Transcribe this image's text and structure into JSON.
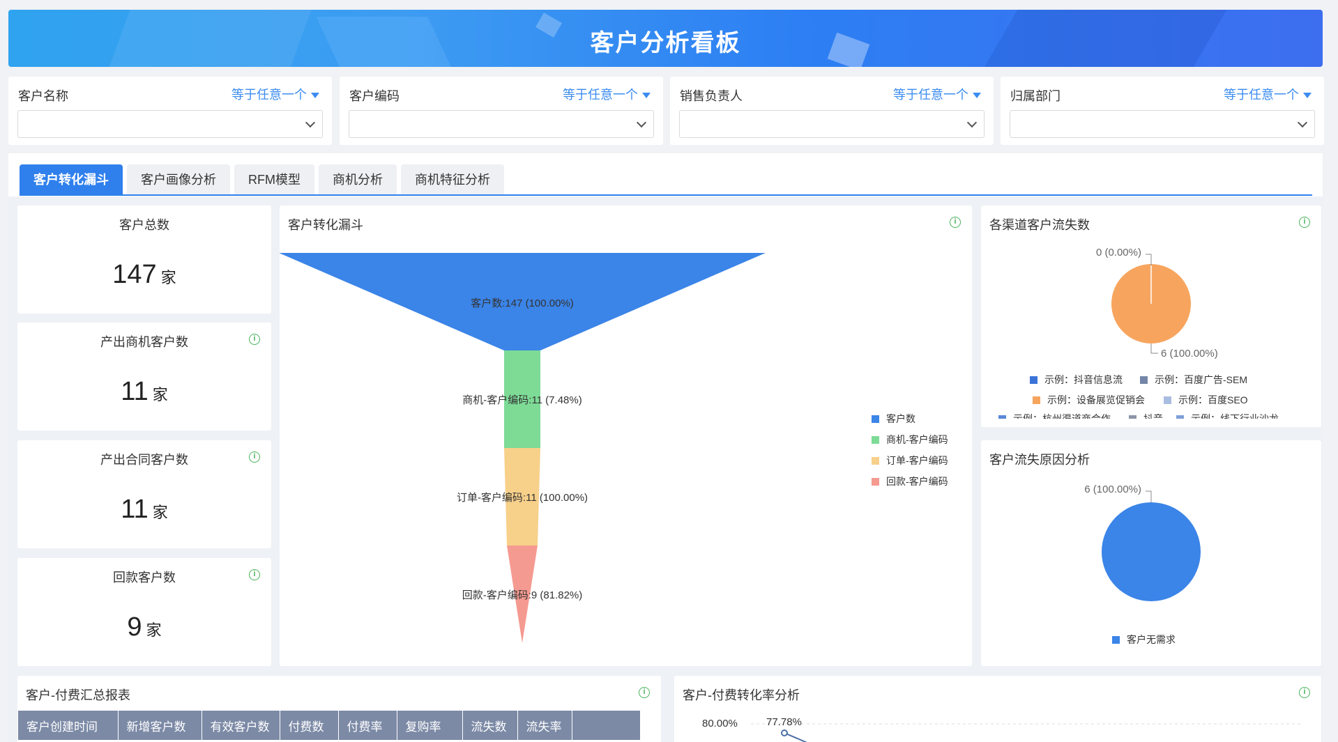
{
  "header": {
    "title": "客户分析看板"
  },
  "filters": [
    {
      "label": "客户名称",
      "operator": "等于任意一个",
      "value": ""
    },
    {
      "label": "客户编码",
      "operator": "等于任意一个",
      "value": ""
    },
    {
      "label": "销售负责人",
      "operator": "等于任意一个",
      "value": ""
    },
    {
      "label": "归属部门",
      "operator": "等于任意一个",
      "value": ""
    }
  ],
  "tabs": [
    {
      "label": "客户转化漏斗",
      "active": true
    },
    {
      "label": "客户画像分析"
    },
    {
      "label": "RFM模型"
    },
    {
      "label": "商机分析"
    },
    {
      "label": "商机特征分析"
    }
  ],
  "kpis": [
    {
      "title": "客户总数",
      "value": "147",
      "unit": "家"
    },
    {
      "title": "产出商机客户数",
      "value": "11",
      "unit": "家"
    },
    {
      "title": "产出合同客户数",
      "value": "11",
      "unit": "家"
    },
    {
      "title": "回款客户数",
      "value": "9",
      "unit": "家"
    }
  ],
  "funnel": {
    "title": "客户转化漏斗",
    "stages": [
      {
        "label": "客户数:147 (100.00%)",
        "legend": "客户数",
        "color": "#3b84e8"
      },
      {
        "label": "商机-客户编码:11 (7.48%)",
        "legend": "商机-客户编码",
        "color": "#7ddb96"
      },
      {
        "label": "订单-客户编码:11 (100.00%)",
        "legend": "订单-客户编码",
        "color": "#f7d08a"
      },
      {
        "label": "回款-客户编码:9 (81.82%)",
        "legend": "回款-客户编码",
        "color": "#f59a90"
      }
    ]
  },
  "churn_channel": {
    "title": "各渠道客户流失数",
    "labels": {
      "top": "0 (0.00%)",
      "bottom": "6 (100.00%)"
    },
    "legend": [
      {
        "name": "示例：抖音信息流",
        "color": "#3b73d8"
      },
      {
        "name": "示例：百度广告-SEM",
        "color": "#7486a8"
      },
      {
        "name": "示例：设备展览促销会",
        "color": "#f7a55e"
      },
      {
        "name": "示例：百度SEO",
        "color": "#a9bde0"
      },
      {
        "name": "示例：杭州渠道商合作",
        "color": "#5b88d8"
      },
      {
        "name": "抖音",
        "color": "#8c95a8"
      },
      {
        "name": "示例：线下行业沙龙",
        "color": "#7f9fd6"
      }
    ]
  },
  "churn_reason": {
    "title": "客户流失原因分析",
    "label": "6 (100.00%)",
    "legend": [
      {
        "name": "客户无需求",
        "color": "#3b84e8"
      }
    ]
  },
  "summary_table": {
    "title": "客户-付费汇总报表",
    "columns": [
      "客户创建时间",
      "新增客户数",
      "有效客户数",
      "付费数",
      "付费率",
      "复购率",
      "流失数",
      "流失率",
      ""
    ]
  },
  "conversion_card": {
    "title": "客户-付费转化率分析",
    "y_tick": "80.00%",
    "point_label": "77.78%"
  },
  "chart_data": [
    {
      "type": "funnel",
      "title": "客户转化漏斗",
      "categories": [
        "客户数",
        "商机-客户编码",
        "订单-客户编码",
        "回款-客户编码"
      ],
      "values": [
        147,
        11,
        11,
        9
      ],
      "percents": [
        100.0,
        7.48,
        100.0,
        81.82
      ]
    },
    {
      "type": "pie",
      "title": "各渠道客户流失数",
      "categories": [
        "示例：设备展览促销会"
      ],
      "values": [
        6
      ],
      "labels": [
        "0 (0.00%)",
        "6 (100.00%)"
      ]
    },
    {
      "type": "pie",
      "title": "客户流失原因分析",
      "categories": [
        "客户无需求"
      ],
      "values": [
        6
      ]
    },
    {
      "type": "line",
      "title": "客户-付费转化率分析",
      "y_ticks": [
        "80.00%"
      ],
      "data_labels": [
        "77.78%"
      ]
    }
  ]
}
